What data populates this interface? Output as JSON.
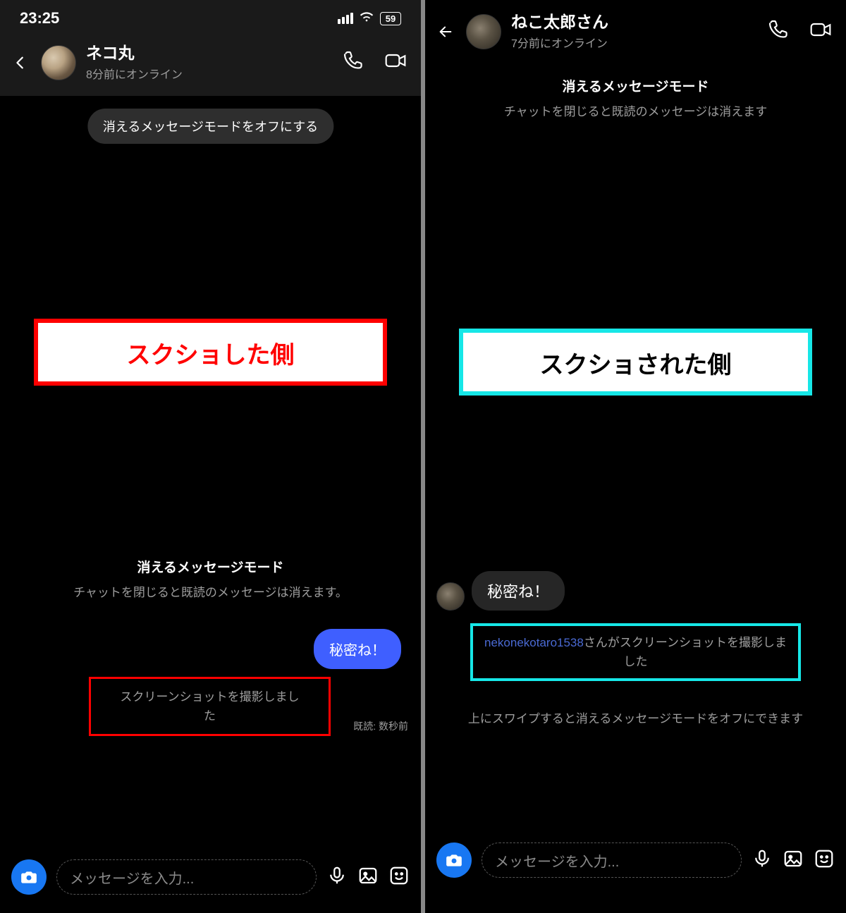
{
  "left": {
    "status": {
      "time": "23:25",
      "battery": "59"
    },
    "header": {
      "name": "ネコ丸",
      "status": "8分前にオンライン"
    },
    "pill_off": "消えるメッセージモードをオフにする",
    "callout": "スクショした側",
    "mode_title": "消えるメッセージモード",
    "mode_sub": "チャットを閉じると既読のメッセージは消えます。",
    "msg_out": "秘密ね！",
    "screenshot_notice": "スクリーンショットを撮影しました",
    "read_receipt": "既読: 数秒前",
    "composer_placeholder": "メッセージを入力..."
  },
  "right": {
    "header": {
      "name": "ねこ太郎さん",
      "status": "7分前にオンライン"
    },
    "mode_title": "消えるメッセージモード",
    "mode_sub": "チャットを閉じると既読のメッセージは消えます",
    "callout": "スクショされた側",
    "msg_in": "秘密ね！",
    "screenshot_username": "nekonekotaro1538",
    "screenshot_suffix": "さんがスクリーンショットを撮影しました",
    "swipe_hint": "上にスワイプすると消えるメッセージモードをオフにできます",
    "composer_placeholder": "メッセージを入力..."
  }
}
